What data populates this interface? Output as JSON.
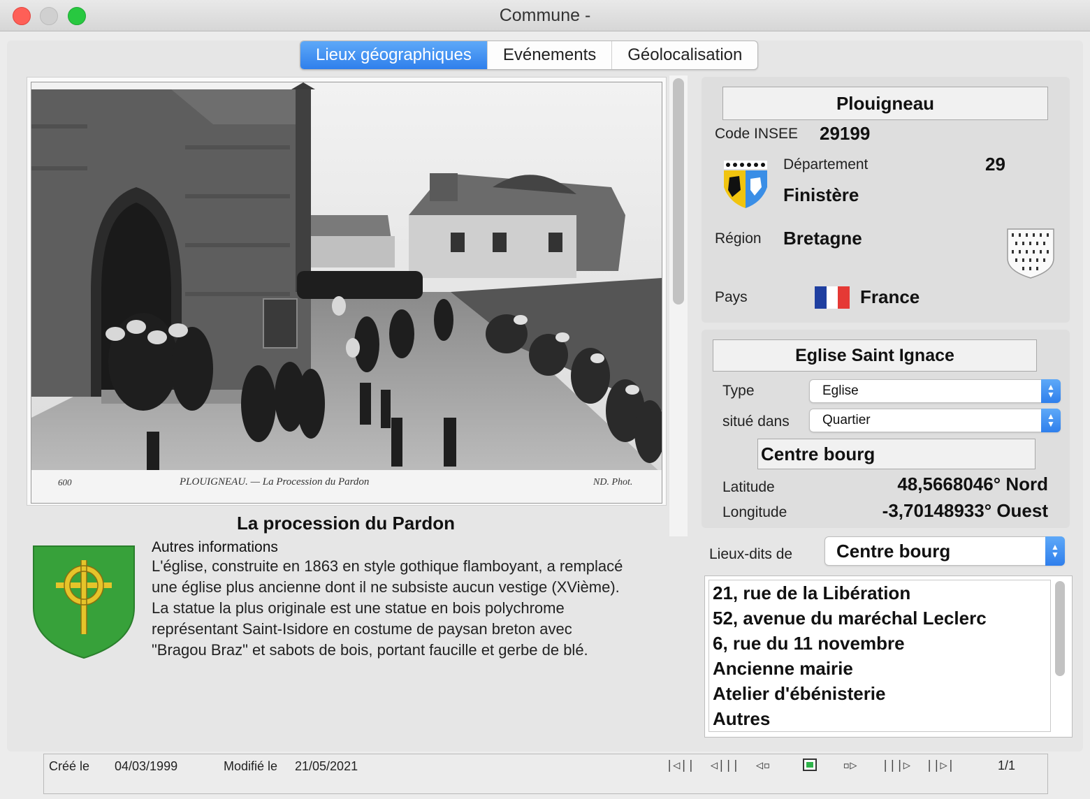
{
  "window": {
    "title": "Commune -",
    "colors": {
      "close": "#fe5f57",
      "minimize": "#d0d0d0",
      "zoom": "#28c840",
      "accent": "#2f7fec"
    }
  },
  "tabs": [
    {
      "label": "Lieux géographiques",
      "active": true
    },
    {
      "label": "Evénements",
      "active": false
    },
    {
      "label": "Géolocalisation",
      "active": false
    }
  ],
  "photo": {
    "caption_left": "600",
    "caption_center": "PLOUIGNEAU. — La Procession du Pardon",
    "caption_right": "ND. Phot."
  },
  "place_caption": "La procession du Pardon",
  "autres": {
    "label": "Autres informations",
    "lines": [
      "L'église, construite en 1863 en style gothique flamboyant, a remplacé",
      "une église plus ancienne dont il ne subsiste aucun vestige (XVième).",
      "La statue la plus originale est une statue en bois polychrome",
      "représentant Saint-Isidore en costume de paysan breton avec",
      "\"Bragou Braz\" et sabots de bois, portant faucille et gerbe de blé."
    ]
  },
  "commune": {
    "name": "Plouigneau",
    "insee_label": "Code INSEE",
    "insee": "29199",
    "departement_label": "Département",
    "departement_code": "29",
    "departement_name": "Finistère",
    "region_label": "Région",
    "region": "Bretagne",
    "pays_label": "Pays",
    "pays": "France"
  },
  "lieu": {
    "name": "Eglise Saint Ignace",
    "type_label": "Type",
    "type_value": "Eglise",
    "situe_label": "situé dans",
    "situe_value": "Quartier",
    "parent_name": "Centre bourg",
    "latitude_label": "Latitude",
    "latitude": "48,5668046° Nord",
    "longitude_label": "Longitude",
    "longitude": "-3,70148933° Ouest"
  },
  "lieux_dits": {
    "label": "Lieux-dits de",
    "selected": "Centre bourg",
    "items": [
      "21, rue de la Libération",
      "52, avenue du maréchal Leclerc",
      "6, rue du 11 novembre",
      "Ancienne mairie",
      "Atelier d'ébénisterie",
      "Autres"
    ]
  },
  "status": {
    "created_label": "Créé le",
    "created": "04/03/1999",
    "modified_label": "Modifié le",
    "modified": "21/05/2021",
    "record": "1/1"
  }
}
